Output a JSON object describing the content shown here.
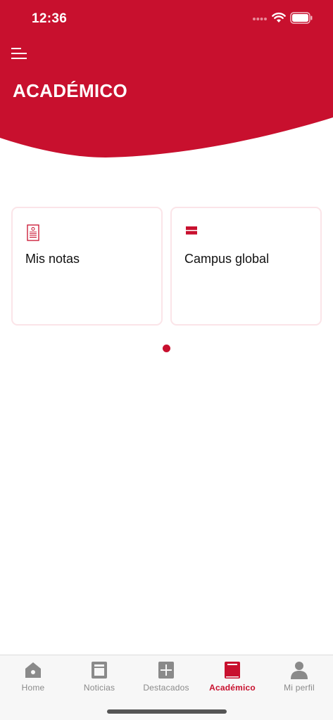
{
  "status_bar": {
    "time": "12:36"
  },
  "header": {
    "title": "ACADÉMICO",
    "menu_icon": "hamburger-menu-icon"
  },
  "cards": [
    {
      "label": "Mis notas",
      "icon": "grades-document-icon"
    },
    {
      "label": "Campus global",
      "icon": "campus-stack-icon"
    }
  ],
  "pagination": {
    "current": 1,
    "total": 1
  },
  "tabs": [
    {
      "label": "Home",
      "icon": "home-icon",
      "active": false
    },
    {
      "label": "Noticias",
      "icon": "news-icon",
      "active": false
    },
    {
      "label": "Destacados",
      "icon": "plus-icon",
      "active": false
    },
    {
      "label": "Académico",
      "icon": "book-icon",
      "active": true
    },
    {
      "label": "Mi perfil",
      "icon": "user-icon",
      "active": false
    }
  ],
  "colors": {
    "brand": "#c8102e",
    "tab_inactive": "#8a8a8a",
    "card_border": "#fbe4e8"
  }
}
